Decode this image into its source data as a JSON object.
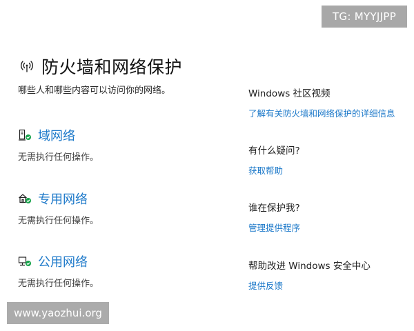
{
  "watermark_top": "TG: MYYJJPP",
  "watermark_bottom": "www.yaozhui.org",
  "header": {
    "title": "防火墙和网络保护",
    "subtitle": "哪些人和哪些内容可以访问你的网络。",
    "icon": "wireless-signal-icon"
  },
  "networks": [
    {
      "label": "域网络",
      "status": "无需执行任何操作。",
      "icon": "domain-network-icon"
    },
    {
      "label": "专用网络",
      "status": "无需执行任何操作。",
      "icon": "private-network-icon"
    },
    {
      "label": "公用网络",
      "status": "无需执行任何操作。",
      "icon": "public-network-icon"
    }
  ],
  "sidebar": [
    {
      "heading": "Windows 社区视频",
      "link": "了解有关防火墙和网络保护的详细信息"
    },
    {
      "heading": "有什么疑问?",
      "link": "获取帮助"
    },
    {
      "heading": "谁在保护我?",
      "link": "管理提供程序"
    },
    {
      "heading": "帮助改进 Windows 安全中心",
      "link": "提供反馈"
    }
  ],
  "colors": {
    "link": "#1b78c9",
    "ok_badge": "#16a34a"
  }
}
